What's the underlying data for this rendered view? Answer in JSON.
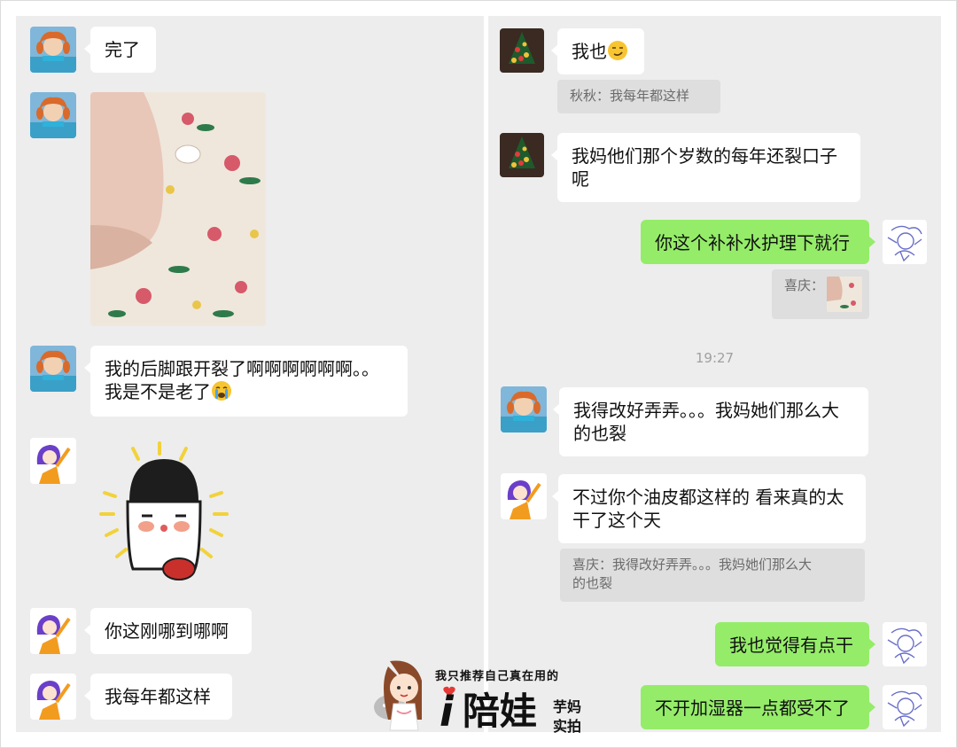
{
  "left_chat": {
    "m1": "完了",
    "m3_line1": "我的后脚跟开裂了啊啊啊啊啊啊。。",
    "m3_line2": "我是不是老了",
    "m5": "你这刚哪到哪啊",
    "m6": "我每年都这样"
  },
  "right_chat": {
    "m1": "我也",
    "q1": "秋秋：我每年都这样",
    "m2_line1": "我妈他们那个岁数的每年还裂口子",
    "m2_line2": "呢",
    "m3": "你这个补补水护理下就行",
    "q2": "喜庆：",
    "time": "19:27",
    "m4_line1": "我得改好弄弄。。。我妈她们那么大",
    "m4_line2": "的也裂",
    "m5_line1": "不过你个油皮都这样的 看来真的太",
    "m5_line2": "干了这个天",
    "q3_line1": "喜庆：我得改好弄弄。。。我妈她们那么大",
    "q3_line2": "的也裂",
    "m6": "我也觉得有点干",
    "m7": "不开加湿器一点都受不了"
  },
  "watermark": {
    "tagline": "我只推荐自己真在用的",
    "brand": "陪娃",
    "brand_prefix": "i",
    "side_top": "芋妈",
    "side_bottom": "实拍"
  },
  "colors": {
    "panel_bg": "#ededed",
    "bubble_self": "#95ec69",
    "bubble_other": "#ffffff",
    "quote_bg": "#dedede"
  },
  "icons": [
    "red-hair-girl-avatar",
    "christmas-tree-avatar",
    "purple-hair-girl-avatar",
    "sketch-avatar",
    "crying-emoji",
    "smirk-emoji",
    "blushing-ghost-sticker",
    "heel-photo",
    "heart-icon"
  ]
}
